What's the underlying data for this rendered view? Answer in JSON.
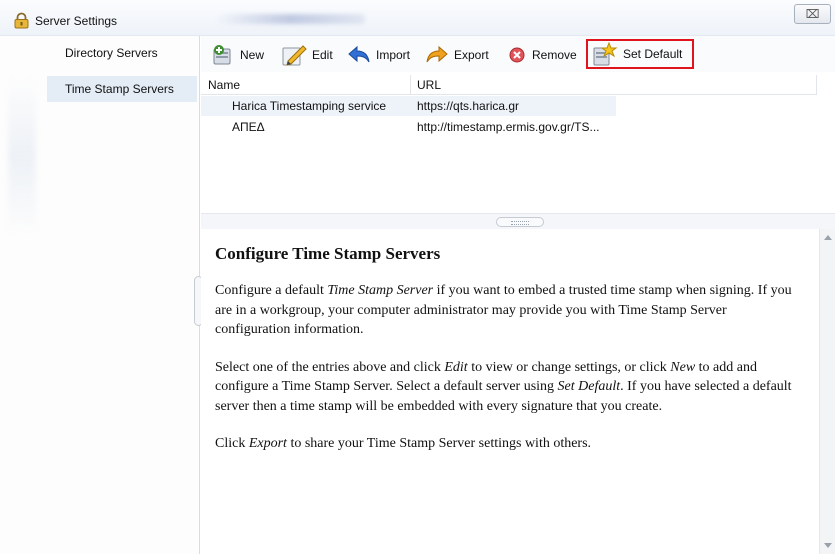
{
  "window": {
    "title": "Server Settings",
    "close_icon": "close-icon",
    "close_glyph": "⌧"
  },
  "sidebar": {
    "items": [
      {
        "label": "Directory Servers",
        "selected": false
      },
      {
        "label": "Time Stamp Servers",
        "selected": true
      }
    ]
  },
  "toolbar": {
    "new_label": "New",
    "edit_label": "Edit",
    "import_label": "Import",
    "export_label": "Export",
    "remove_label": "Remove",
    "set_default_label": "Set Default",
    "highlight_color": "#e0141d"
  },
  "table": {
    "columns": [
      "Name",
      "URL"
    ],
    "rows": [
      {
        "name": "Harica Timestamping service",
        "url": "https://qts.harica.gr",
        "selected": true
      },
      {
        "name": "ΑΠΕΔ",
        "url": "http://timestamp.ermis.gov.gr/TS...",
        "selected": false
      }
    ]
  },
  "help": {
    "heading": "Configure Time Stamp Servers",
    "p1": {
      "a": "Configure a default ",
      "em": "Time Stamp Server",
      "b": " if you want to embed a trusted time stamp when signing. If you are in a workgroup, your computer administrator may provide you with Time Stamp Server configuration information."
    },
    "p2": {
      "a": "Select one of the entries above and click ",
      "em1": "Edit",
      "b": " to view or change settings, or click ",
      "em2": "New",
      "c": " to add and configure a Time Stamp Server. Select a default server using ",
      "em3": "Set Default",
      "d": ". If you have selected a default server then a time stamp will be embedded with every signature that you create."
    },
    "p3": {
      "a": "Click ",
      "em": "Export",
      "b": " to share your Time Stamp Server settings with others."
    }
  }
}
